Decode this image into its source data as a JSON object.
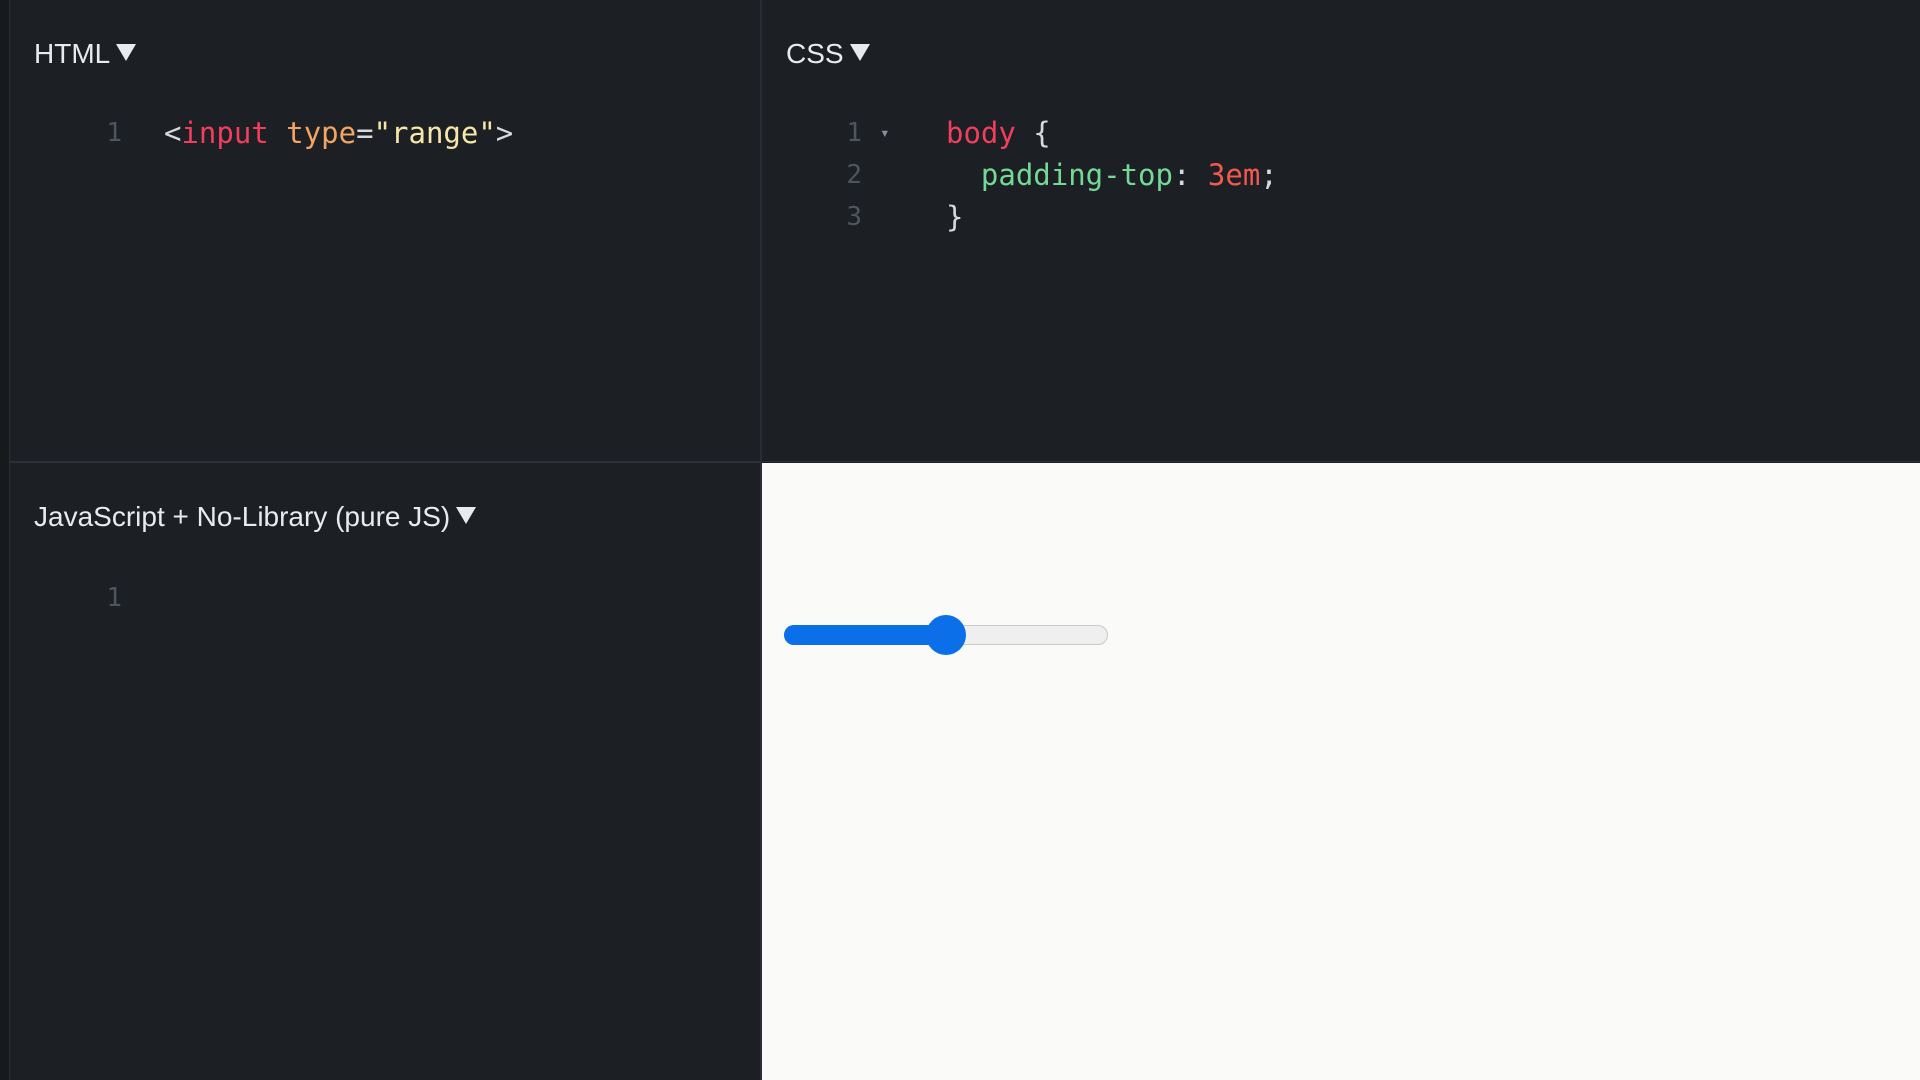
{
  "panels": {
    "html": {
      "title": "HTML",
      "lines": [
        {
          "n": "1",
          "tokens": [
            {
              "t": "<",
              "c": "c-punct"
            },
            {
              "t": "input",
              "c": "c-tag"
            },
            {
              "t": " ",
              "c": "c-punct"
            },
            {
              "t": "type",
              "c": "c-attr"
            },
            {
              "t": "=",
              "c": "c-punct"
            },
            {
              "t": "\"range\"",
              "c": "c-str"
            },
            {
              "t": ">",
              "c": "c-punct"
            }
          ]
        }
      ]
    },
    "css": {
      "title": "CSS",
      "lines": [
        {
          "n": "1",
          "fold": "▾",
          "tokens": [
            {
              "t": "body",
              "c": "c-sel"
            },
            {
              "t": " {",
              "c": "c-punct"
            }
          ]
        },
        {
          "n": "2",
          "tokens": [
            {
              "t": "  padding-top",
              "c": "c-prop"
            },
            {
              "t": ": ",
              "c": "c-punct"
            },
            {
              "t": "3em",
              "c": "c-num"
            },
            {
              "t": ";",
              "c": "c-punct"
            }
          ]
        },
        {
          "n": "3",
          "tokens": [
            {
              "t": "}",
              "c": "c-punct"
            }
          ]
        }
      ]
    },
    "js": {
      "title": "JavaScript + No-Library (pure JS)",
      "lines": [
        {
          "n": "1",
          "tokens": []
        }
      ]
    }
  },
  "preview": {
    "range": {
      "value": 50,
      "min": 0,
      "max": 100
    }
  },
  "colors": {
    "editor_bg": "#1c1f24",
    "preview_bg": "#fafaf8",
    "accent": "#0a6fe8"
  }
}
